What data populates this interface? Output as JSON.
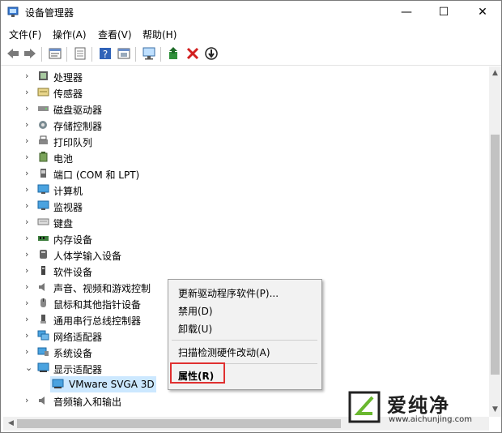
{
  "window": {
    "title": "设备管理器",
    "min_glyph": "—",
    "max_glyph": "☐",
    "close_glyph": "✕"
  },
  "menubar": {
    "items": [
      "文件(F)",
      "操作(A)",
      "查看(V)",
      "帮助(H)"
    ]
  },
  "toolbar": {
    "icons": [
      "back-icon",
      "forward-icon",
      "properties-icon",
      "refresh-icon",
      "help-icon",
      "view-icon",
      "monitor-icon",
      "update-driver-icon",
      "uninstall-icon",
      "scan-icon"
    ]
  },
  "tree": {
    "categories": [
      {
        "label": "处理器",
        "icon": "processor-icon"
      },
      {
        "label": "传感器",
        "icon": "sensor-icon"
      },
      {
        "label": "磁盘驱动器",
        "icon": "disk-drive-icon"
      },
      {
        "label": "存储控制器",
        "icon": "storage-controller-icon"
      },
      {
        "label": "打印队列",
        "icon": "printer-icon"
      },
      {
        "label": "电池",
        "icon": "battery-icon"
      },
      {
        "label": "端口 (COM 和 LPT)",
        "icon": "port-icon"
      },
      {
        "label": "计算机",
        "icon": "computer-icon"
      },
      {
        "label": "监视器",
        "icon": "monitor-icon"
      },
      {
        "label": "键盘",
        "icon": "keyboard-icon"
      },
      {
        "label": "内存设备",
        "icon": "memory-icon"
      },
      {
        "label": "人体学输入设备",
        "icon": "hid-icon"
      },
      {
        "label": "软件设备",
        "icon": "software-device-icon"
      },
      {
        "label": "声音、视频和游戏控制",
        "icon": "audio-icon"
      },
      {
        "label": "鼠标和其他指针设备",
        "icon": "mouse-icon"
      },
      {
        "label": "通用串行总线控制器",
        "icon": "usb-icon"
      },
      {
        "label": "网络适配器",
        "icon": "network-icon"
      },
      {
        "label": "系统设备",
        "icon": "system-device-icon"
      },
      {
        "label": "显示适配器",
        "icon": "display-adapter-icon",
        "expanded": true
      },
      {
        "label": "VMware SVGA 3D",
        "icon": "display-device-icon",
        "child": true,
        "selected": true
      },
      {
        "label": "音频输入和输出",
        "icon": "audio-io-icon"
      }
    ]
  },
  "context_menu": {
    "items": [
      "更新驱动程序软件(P)...",
      "禁用(D)",
      "卸载(U)",
      "扫描检测硬件改动(A)",
      "属性(R)"
    ],
    "highlighted": "属性(R)"
  },
  "watermark": {
    "text": "爱纯净",
    "url": "www.aichunjing.com"
  },
  "colors": {
    "selection": "#cce8ff",
    "highlight_border": "#e03030",
    "menu_bg": "#f2f2f2"
  }
}
